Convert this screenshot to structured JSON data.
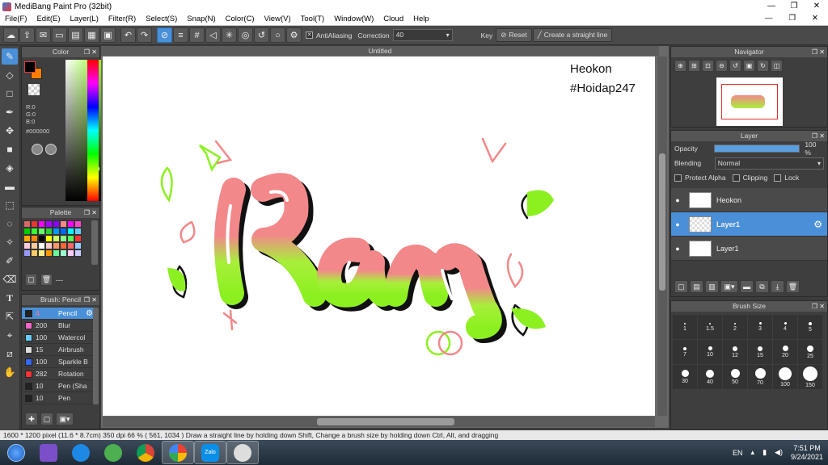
{
  "window": {
    "title": "MediBang Paint Pro (32bit)",
    "min": "—",
    "max": "❐",
    "close": "✕"
  },
  "menu": {
    "items": [
      "File(F)",
      "Edit(E)",
      "Layer(L)",
      "Filter(R)",
      "Select(S)",
      "Snap(N)",
      "Color(C)",
      "View(V)",
      "Tool(T)",
      "Window(W)",
      "Cloud",
      "Help"
    ],
    "right": [
      "—",
      "❐",
      "✕"
    ]
  },
  "toolbar": {
    "antialiasing_label": "AntiAliasing",
    "correction_label": "Correction",
    "correction_value": "40",
    "key_label": "Key",
    "reset_label": "Reset",
    "straight_line_label": "Create a straight line"
  },
  "color_panel": {
    "title": "Color",
    "r": "R:0",
    "g": "G:0",
    "b": "B:0",
    "hex": "#000000",
    "primary_color": "#000000",
    "secondary_color": "#ff8000"
  },
  "palette_panel": {
    "title": "Palette",
    "extra": "---",
    "swatches": [
      "#d66",
      "#e33",
      "#f0f",
      "#a0f",
      "#80f",
      "#f88",
      "#f0f",
      "#f4c",
      "#0c0",
      "#3f3",
      "#6f6",
      "#3c3",
      "#09f",
      "#06f",
      "#0ff",
      "#6cf",
      "#fa0",
      "#f80",
      "#000",
      "#ff0",
      "#cf6",
      "#8f8",
      "#5f5",
      "#f33",
      "#fcd",
      "#fc9",
      "#fff",
      "#fcc",
      "#f96",
      "#f63",
      "#f66",
      "#9cf",
      "#99f",
      "#fc6",
      "#fe8",
      "#f90",
      "#6f9",
      "#9fc",
      "#fcf",
      "#ccf"
    ]
  },
  "brush_panel": {
    "title": "Brush: Pencil",
    "brushes": [
      {
        "size": "4",
        "name": "Pencil",
        "color": "#222222",
        "selected": true
      },
      {
        "size": "200",
        "name": "Blur",
        "color": "#ff66cc",
        "selected": false
      },
      {
        "size": "100",
        "name": "Watercol",
        "color": "#66ccff",
        "selected": false
      },
      {
        "size": "15",
        "name": "Airbrush",
        "color": "#dddddd",
        "selected": false
      },
      {
        "size": "100",
        "name": "Sparkle B",
        "color": "#3366ff",
        "selected": false
      },
      {
        "size": "282",
        "name": "Rotation",
        "color": "#ff3333",
        "selected": false
      },
      {
        "size": "10",
        "name": "Pen (Sha",
        "color": "#222222",
        "selected": false
      },
      {
        "size": "10",
        "name": "Pen",
        "color": "#222222",
        "selected": false
      }
    ]
  },
  "canvas": {
    "tab_title": "Untitled",
    "watermark_line1": "Heokon",
    "watermark_line2": "#Hoidap247",
    "artwork_text": "Rắn"
  },
  "navigator_panel": {
    "title": "Navigator"
  },
  "layer_panel": {
    "title": "Layer",
    "opacity_label": "Opacity",
    "opacity_value": "100 %",
    "opacity_fraction": 1.0,
    "blending_label": "Blending",
    "blending_value": "Normal",
    "protect_alpha": "Protect Alpha",
    "clipping": "Clipping",
    "lock": "Lock",
    "layers": [
      {
        "name": "Heokon",
        "selected": false
      },
      {
        "name": "Layer1",
        "selected": true
      },
      {
        "name": "Layer1",
        "selected": false
      }
    ]
  },
  "brushsize_panel": {
    "title": "Brush Size",
    "sizes": [
      "1",
      "1.5",
      "2",
      "3",
      "4",
      "5",
      "7",
      "10",
      "12",
      "15",
      "20",
      "25",
      "30",
      "40",
      "50",
      "70",
      "100",
      "150"
    ]
  },
  "status": {
    "text": "1600 * 1200 pixel  (11.6 * 8.7cm)  350 dpi  66 %  ( 561, 1034 )  Draw a straight line by holding down Shift, Change a brush size by holding down Ctrl, Alt, and dragging"
  },
  "taskbar": {
    "lang": "EN",
    "time": "7:51 PM",
    "date": "9/24/2021",
    "zalo_label": "Zalo"
  }
}
